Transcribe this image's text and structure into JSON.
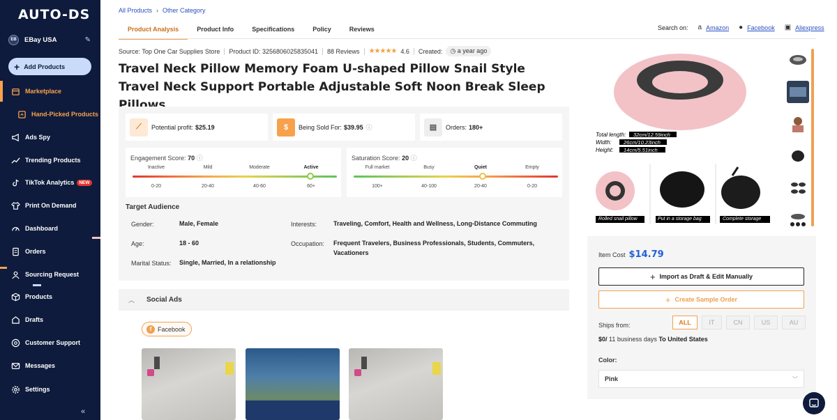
{
  "sidebar": {
    "logo": "AUTO-DS",
    "store": {
      "initials": "EB",
      "name": "EBay USA"
    },
    "add_products": "Add Products",
    "items": [
      {
        "label": "Marketplace",
        "icon": "store-icon"
      },
      {
        "label": "Hand-Picked Products",
        "icon": "hand-picked-icon"
      },
      {
        "label": "Ads Spy",
        "icon": "megaphone-icon"
      },
      {
        "label": "Trending Products",
        "icon": "trend-icon"
      },
      {
        "label": "TikTok Analytics",
        "icon": "tiktok-icon",
        "badge": "NEW"
      },
      {
        "label": "Print On Demand",
        "icon": "shirt-icon"
      },
      {
        "label": "Dashboard",
        "icon": "gauge-icon"
      },
      {
        "label": "Orders",
        "icon": "orders-icon"
      },
      {
        "label": "Sourcing Request",
        "icon": "sourcing-icon"
      },
      {
        "label": "Products",
        "icon": "box-icon"
      },
      {
        "label": "Drafts",
        "icon": "drafts-icon"
      },
      {
        "label": "Customer Support",
        "icon": "support-icon"
      },
      {
        "label": "Messages",
        "icon": "mail-icon"
      },
      {
        "label": "Settings",
        "icon": "gear-icon"
      }
    ],
    "collapse": "«"
  },
  "breadcrumb": {
    "root": "All Products",
    "current": "Other Category"
  },
  "tabs": [
    "Product Analysis",
    "Product Info",
    "Specifications",
    "Policy",
    "Reviews"
  ],
  "search_on": {
    "label": "Search on:",
    "links": [
      "Amazon",
      "Facebook",
      "Aliexpress"
    ]
  },
  "product": {
    "source": "Source: Top One Car Supplies Store",
    "product_id": "Product ID: 3256806025835041",
    "reviews": "88 Reviews",
    "rating": "4.6",
    "rating_value": 4.6,
    "created_label": "Created:",
    "created_value": "a year ago",
    "title": "Travel Neck Pillow Memory Foam U-shaped Pillow Snail Style Travel Neck Support Portable Adjustable Soft Noon Break Sleep Pillows"
  },
  "stats": {
    "profit_label": "Potential profit:",
    "profit_value": "$25.19",
    "sold_label": "Being Sold For:",
    "sold_value": "$39.95",
    "orders_label": "Orders:",
    "orders_value": "180+"
  },
  "engagement": {
    "label": "Engagement Score:",
    "value": "70",
    "score": 70,
    "levels": [
      "Inactive",
      "Mild",
      "Moderate",
      "Active"
    ],
    "ranges": [
      "0-20",
      "20-40",
      "40-60",
      "60+"
    ]
  },
  "saturation": {
    "label": "Saturation Score:",
    "value": "20",
    "score": 20,
    "levels": [
      "Full market",
      "Busy",
      "Quiet",
      "Empty"
    ],
    "ranges": [
      "100+",
      "40-100",
      "20-40",
      "0-20"
    ]
  },
  "audience": {
    "title": "Target Audience",
    "gender_label": "Gender:",
    "gender": "Male, Female",
    "age_label": "Age:",
    "age": "18 - 60",
    "marital_label": "Marital Status:",
    "marital": "Single, Married, In a relationship",
    "interests_label": "Interests:",
    "interests": "Traveling, Comfort, Health and Wellness, Long-Distance Commuting",
    "occupation_label": "Occupation:",
    "occupation": "Frequent Travelers, Business Professionals, Students, Commuters, Vacationers"
  },
  "social": {
    "title": "Social Ads",
    "filter": "Facebook"
  },
  "gallery": {
    "dims": [
      "Total length:",
      "Width:",
      "Height:"
    ],
    "dim_values": [
      "32cm/12.59inch",
      "26cm/10.23inch",
      "14cm/5.51inch"
    ],
    "captions": [
      "Rolled snail pillow",
      "Put in a storage bag",
      "Complete storage"
    ]
  },
  "purchase": {
    "item_cost_label": "Item Cost",
    "item_cost": "$14.79",
    "import_btn": "Import as Draft & Edit Manually",
    "sample_btn": "Create Sample Order",
    "ships_from": "Ships from:",
    "countries": [
      "ALL",
      "IT",
      "CN",
      "US",
      "AU"
    ],
    "shipping_price": "$0/",
    "shipping_days": "11 business days",
    "shipping_dest": "To United States",
    "color_label": "Color:",
    "color_value": "Pink"
  },
  "colors": {
    "sidebar": "#0e1b3c",
    "accent": "#f0a050",
    "link": "#2a4fbf",
    "price": "#1f5fd6"
  }
}
